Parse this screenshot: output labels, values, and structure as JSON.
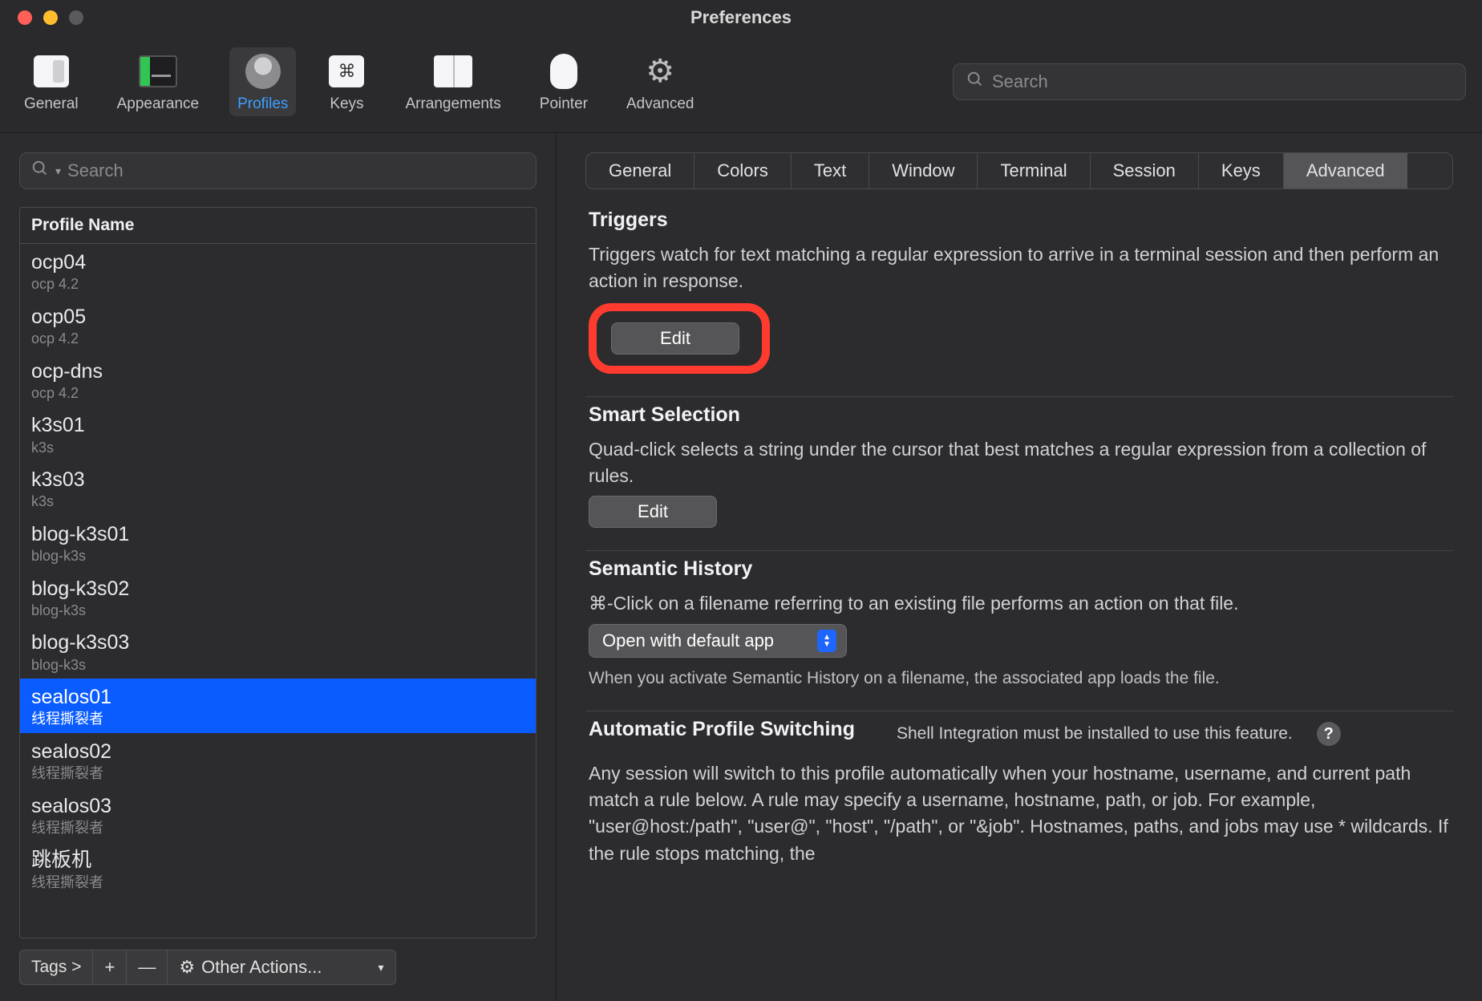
{
  "window": {
    "title": "Preferences"
  },
  "toolbar": {
    "items": [
      {
        "label": "General"
      },
      {
        "label": "Appearance"
      },
      {
        "label": "Profiles"
      },
      {
        "label": "Keys"
      },
      {
        "label": "Arrangements"
      },
      {
        "label": "Pointer"
      },
      {
        "label": "Advanced"
      }
    ],
    "search_placeholder": "Search"
  },
  "sidebar": {
    "search_placeholder": "Search",
    "header": "Profile Name",
    "profiles": [
      {
        "name": "ocp04",
        "sub": "ocp 4.2"
      },
      {
        "name": "ocp05",
        "sub": "ocp 4.2"
      },
      {
        "name": "ocp-dns",
        "sub": "ocp 4.2"
      },
      {
        "name": "k3s01",
        "sub": "k3s"
      },
      {
        "name": "k3s03",
        "sub": "k3s"
      },
      {
        "name": "blog-k3s01",
        "sub": "blog-k3s"
      },
      {
        "name": "blog-k3s02",
        "sub": "blog-k3s"
      },
      {
        "name": "blog-k3s03",
        "sub": "blog-k3s"
      },
      {
        "name": "sealos01",
        "sub": "线程撕裂者",
        "selected": true
      },
      {
        "name": "sealos02",
        "sub": "线程撕裂者"
      },
      {
        "name": "sealos03",
        "sub": "线程撕裂者"
      },
      {
        "name": "跳板机",
        "sub": "线程撕裂者"
      }
    ],
    "footer": {
      "tags": "Tags >",
      "add": "+",
      "remove": "—",
      "other_actions": "Other Actions..."
    }
  },
  "tabs": [
    "General",
    "Colors",
    "Text",
    "Window",
    "Terminal",
    "Session",
    "Keys",
    "Advanced"
  ],
  "active_tab": "Advanced",
  "sections": {
    "triggers": {
      "title": "Triggers",
      "desc": "Triggers watch for text matching a regular expression to arrive in a terminal session and then perform an action in response.",
      "edit": "Edit"
    },
    "smart": {
      "title": "Smart Selection",
      "desc": "Quad-click selects a string under the cursor that best matches a regular expression from a collection of rules.",
      "edit": "Edit"
    },
    "semantic": {
      "title": "Semantic History",
      "desc": "⌘-Click on a filename referring to an existing file performs an action on that file.",
      "popup": "Open with default app",
      "note": "When you activate Semantic History on a filename, the associated app loads the file."
    },
    "aps": {
      "title": "Automatic Profile Switching",
      "hint": "Shell Integration must be installed to use this feature.",
      "desc": "Any session will switch to this profile automatically when your hostname, username, and current path match a rule below. A rule may specify a username, hostname, path, or job. For example, \"user@host:/path\", \"user@\", \"host\", \"/path\", or \"&job\". Hostnames, paths, and jobs may use * wildcards. If the rule stops matching, the"
    }
  }
}
